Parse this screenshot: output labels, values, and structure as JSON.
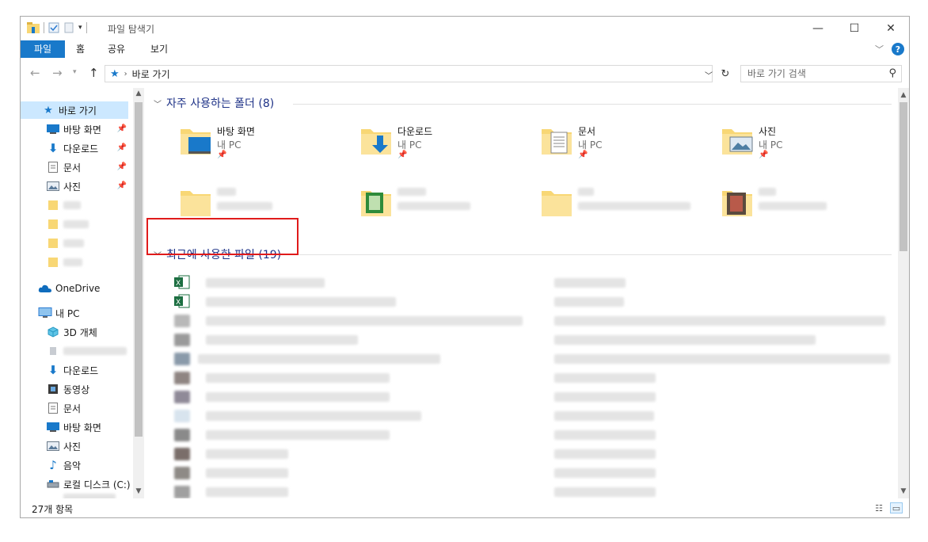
{
  "window": {
    "title": "파일 탐색기"
  },
  "ribbon": {
    "tabs": [
      "파일",
      "홈",
      "공유",
      "보기"
    ]
  },
  "address": {
    "breadcrumb": "바로 가기",
    "search_placeholder": "바로 가기 검색"
  },
  "sidebar": {
    "items": [
      {
        "label": "바로 가기",
        "icon": "star-icon",
        "selected": true
      },
      {
        "label": "바탕 화면",
        "icon": "desktop-icon",
        "pinned": true
      },
      {
        "label": "다운로드",
        "icon": "download-icon",
        "pinned": true
      },
      {
        "label": "문서",
        "icon": "document-icon",
        "pinned": true
      },
      {
        "label": "사진",
        "icon": "pictures-icon",
        "pinned": true
      },
      {
        "label": "OneDrive",
        "icon": "cloud-icon"
      },
      {
        "label": "내 PC",
        "icon": "pc-icon"
      },
      {
        "label": "3D 개체",
        "icon": "cube-icon"
      },
      {
        "label": "다운로드",
        "icon": "download-icon"
      },
      {
        "label": "동영상",
        "icon": "video-icon"
      },
      {
        "label": "문서",
        "icon": "document-icon"
      },
      {
        "label": "바탕 화면",
        "icon": "desktop-icon"
      },
      {
        "label": "사진",
        "icon": "pictures-icon"
      },
      {
        "label": "음악",
        "icon": "music-icon"
      },
      {
        "label": "로컬 디스크 (C:)",
        "icon": "drive-icon"
      }
    ]
  },
  "main": {
    "frequent": {
      "header": "자주 사용하는 폴더 (8)",
      "folders": [
        {
          "name": "바탕 화면",
          "location": "내 PC",
          "overlay": "desktop-icon"
        },
        {
          "name": "다운로드",
          "location": "내 PC",
          "overlay": "download-icon"
        },
        {
          "name": "문서",
          "location": "내 PC",
          "overlay": "document-icon"
        },
        {
          "name": "사진",
          "location": "내 PC",
          "overlay": "pictures-icon"
        }
      ]
    },
    "recent": {
      "header": "최근에 사용한 파일 (19)"
    }
  },
  "status": {
    "item_count": "27개 항목"
  },
  "colors": {
    "accent": "#1979ca",
    "group_header": "#1e3287",
    "selection": "#cce8ff",
    "folder": "#f8d775",
    "highlight_box": "#e01b1b"
  }
}
